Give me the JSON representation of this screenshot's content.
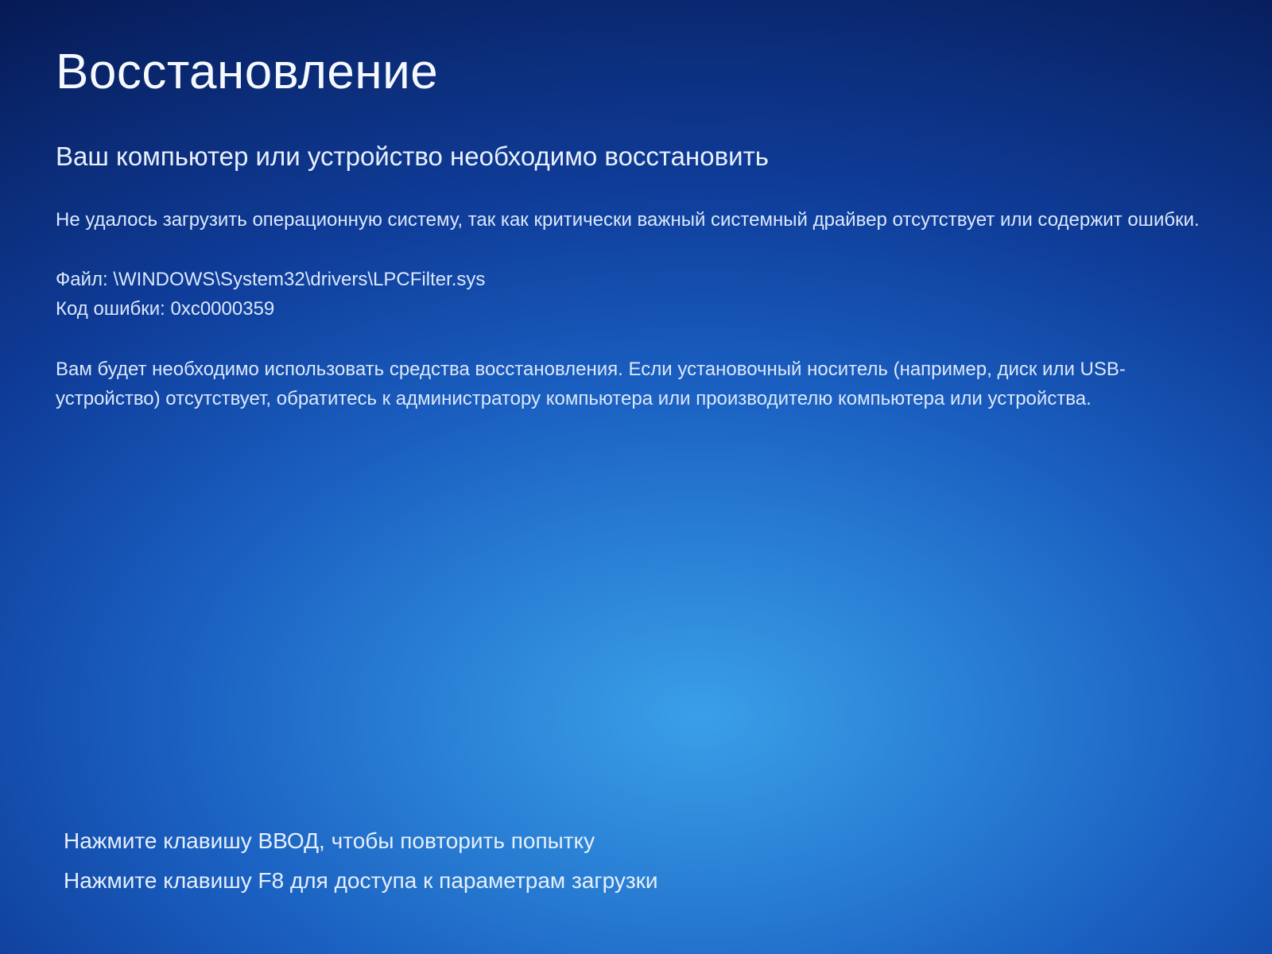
{
  "screen": {
    "title": "Восстановление",
    "subtitle": "Ваш компьютер или устройство необходимо восстановить",
    "error_description": "Не удалось загрузить операционную систему, так как критически важный системный драйвер отсутствует или содержит ошибки.",
    "file_label": "Файл:",
    "file_path": "\\WINDOWS\\System32\\drivers\\LPCFilter.sys",
    "error_code_label": "Код ошибки:",
    "error_code": "0xc0000359",
    "recovery_instruction": "Вам будет необходимо использовать средства восстановления. Если установочный носитель (например, диск или USB-устройство) отсутствует, обратитесь к администратору компьютера или производителю компьютера или устройства."
  },
  "footer": {
    "hint_enter": "Нажмите клавишу ВВОД, чтобы повторить попытку",
    "hint_f8": "Нажмите клавишу F8 для доступа к параметрам загрузки"
  }
}
